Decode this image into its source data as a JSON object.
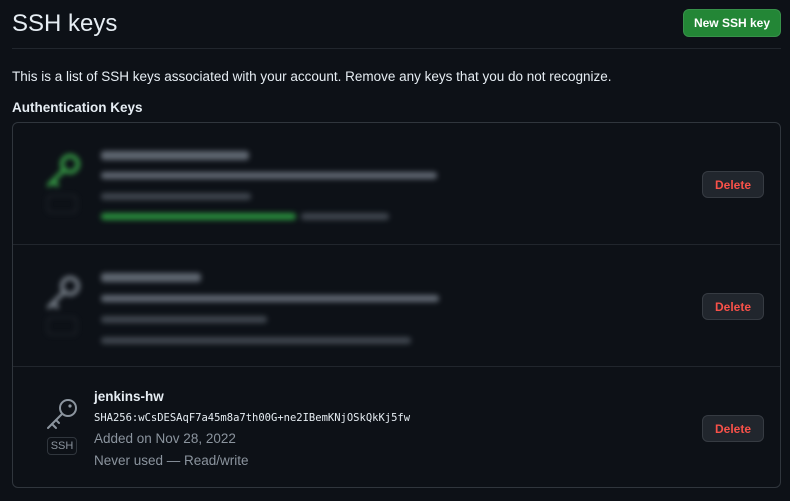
{
  "page": {
    "title": "SSH keys",
    "new_key_button": "New SSH key",
    "description": "This is a list of SSH keys associated with your account. Remove any keys that you do not recognize.",
    "section_title": "Authentication Keys"
  },
  "keys": [
    {
      "redacted": true,
      "icon": "key-icon",
      "icon_color": "#3fb950",
      "badge": "SSH",
      "delete_label": "Delete"
    },
    {
      "redacted": true,
      "icon": "key-icon",
      "icon_color": "#8b949e",
      "badge": "SSH",
      "delete_label": "Delete"
    },
    {
      "redacted": false,
      "icon": "key-icon",
      "icon_color": "#8b949e",
      "name": "jenkins-hw",
      "fingerprint": "SHA256:wCsDESAqF7a45m8a7th00G+ne2IBemKNjOSkQkKj5fw",
      "added": "Added on Nov 28, 2022",
      "usage": "Never used — Read/write",
      "badge": "SSH",
      "delete_label": "Delete"
    }
  ],
  "colors": {
    "primary_button": "#238636",
    "danger_text": "#f85149",
    "background": "#0d1117",
    "border": "#30363d"
  }
}
